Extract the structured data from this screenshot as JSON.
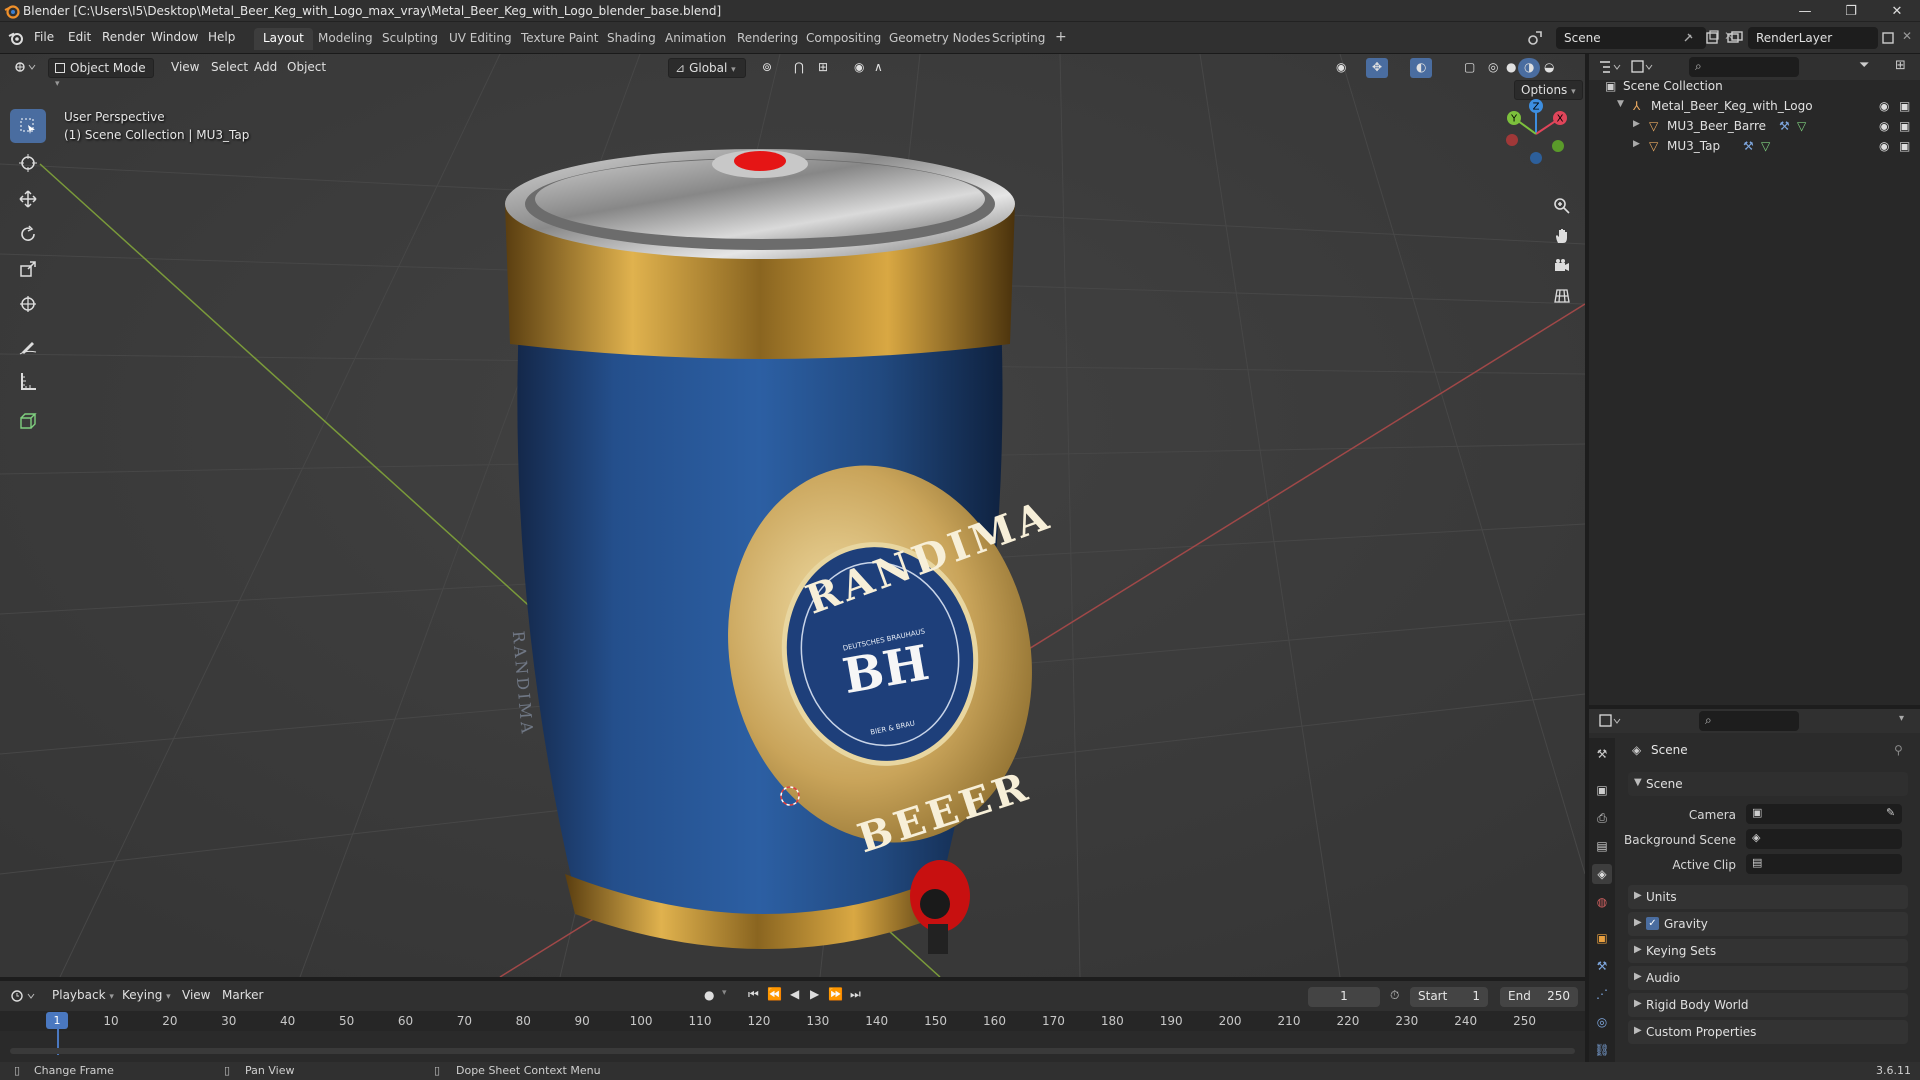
{
  "window": {
    "title": "Blender [C:\\Users\\I5\\Desktop\\Metal_Beer_Keg_with_Logo_max_vray\\Metal_Beer_Keg_with_Logo_blender_base.blend]",
    "minimize": "—",
    "maximize": "❐",
    "close": "✕"
  },
  "menu": {
    "items": [
      "File",
      "Edit",
      "Render",
      "Window",
      "Help"
    ]
  },
  "workspaces": {
    "tabs": [
      "Layout",
      "Modeling",
      "Sculpting",
      "UV Editing",
      "Texture Paint",
      "Shading",
      "Animation",
      "Rendering",
      "Compositing",
      "Geometry Nodes",
      "Scripting"
    ],
    "active": "Layout",
    "add": "+"
  },
  "scene_selector": {
    "scene": "Scene",
    "render_layer": "RenderLayer"
  },
  "viewport": {
    "mode": "Object Mode",
    "menus": [
      "View",
      "Select",
      "Add",
      "Object"
    ],
    "transform_orientation": "Global",
    "options": "Options",
    "overlay_line1": "User Perspective",
    "overlay_line2": "(1) Scene Collection | MU3_Tap",
    "gizmo_axes": {
      "x": "X",
      "y": "Y",
      "z": "Z"
    }
  },
  "keg_label": {
    "arc_top": "RANDIMA",
    "arc_bottom": "BEEER",
    "monogram": "BH",
    "small_top": "DEUTSCHES BRAUHAUS",
    "small_bottom": "BIER & BRAU",
    "side_text": "RANDIMA"
  },
  "outliner": {
    "root": "Scene Collection",
    "collection": "Metal_Beer_Keg_with_Logo",
    "objects": [
      "MU3_Beer_Barre",
      "MU3_Tap"
    ]
  },
  "properties": {
    "title": "Scene",
    "section": "Scene",
    "fields": [
      {
        "label": "Camera",
        "value": ""
      },
      {
        "label": "Background Scene",
        "value": ""
      },
      {
        "label": "Active Clip",
        "value": ""
      }
    ],
    "panels": [
      "Units",
      "Gravity",
      "Keying Sets",
      "Audio",
      "Rigid Body World",
      "Custom Properties"
    ],
    "gravity_checked": true
  },
  "timeline": {
    "menus": [
      "Playback",
      "Keying",
      "View",
      "Marker"
    ],
    "current_frame": "1",
    "start_label": "Start",
    "start": "1",
    "end_label": "End",
    "end": "250",
    "ticks": [
      "10",
      "20",
      "30",
      "40",
      "50",
      "60",
      "70",
      "80",
      "90",
      "100",
      "110",
      "120",
      "130",
      "140",
      "150",
      "160",
      "170",
      "180",
      "190",
      "200",
      "210",
      "220",
      "230",
      "240",
      "250"
    ],
    "playhead": "1"
  },
  "statusbar": {
    "hints": [
      "Change Frame",
      "Pan View",
      "Dope Sheet Context Menu"
    ],
    "version": "3.6.11"
  },
  "colors": {
    "accent": "#4a6da0",
    "keg_blue": "#1f4a8a",
    "gold": "#c9a44a",
    "tap_red": "#d01515",
    "axis_x": "#e0455a",
    "axis_y": "#7cc03c",
    "axis_z": "#3d8ee0"
  }
}
